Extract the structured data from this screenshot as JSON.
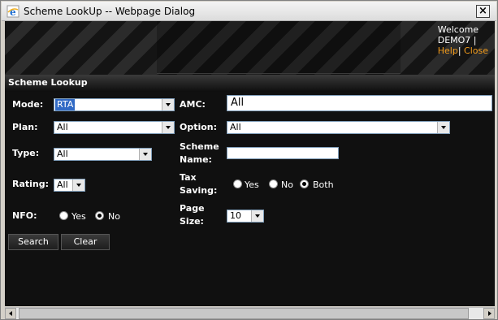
{
  "window": {
    "title": "Scheme LookUp -- Webpage Dialog",
    "close_label": "×"
  },
  "header": {
    "welcome": "Welcome",
    "user": "DEMO7 |",
    "help": "Help",
    "sep": "|",
    "close": "Close"
  },
  "section": {
    "title": "Scheme Lookup"
  },
  "form": {
    "mode": {
      "label": "Mode:",
      "value": "RTA"
    },
    "amc": {
      "label": "AMC:",
      "value": "All"
    },
    "plan": {
      "label": "Plan:",
      "value": "All"
    },
    "option": {
      "label": "Option:",
      "value": "All"
    },
    "type": {
      "label": "Type:",
      "value": "All"
    },
    "scheme_name": {
      "label_line1": "Scheme",
      "label_line2": "Name:",
      "value": ""
    },
    "rating": {
      "label": "Rating:",
      "value": "All"
    },
    "tax_saving": {
      "label_line1": "Tax",
      "label_line2": "Saving:",
      "options": [
        "Yes",
        "No",
        "Both"
      ],
      "selected": "Both"
    },
    "nfo": {
      "label": "NFO:",
      "options": [
        "Yes",
        "No"
      ],
      "selected": "No"
    },
    "page_size": {
      "label_line1": "Page",
      "label_line2": "Size:",
      "value": "10"
    }
  },
  "buttons": {
    "search": "Search",
    "clear": "Clear"
  },
  "colors": {
    "background": "#101010",
    "link": "#f39c1b",
    "selection": "#316ac5"
  }
}
